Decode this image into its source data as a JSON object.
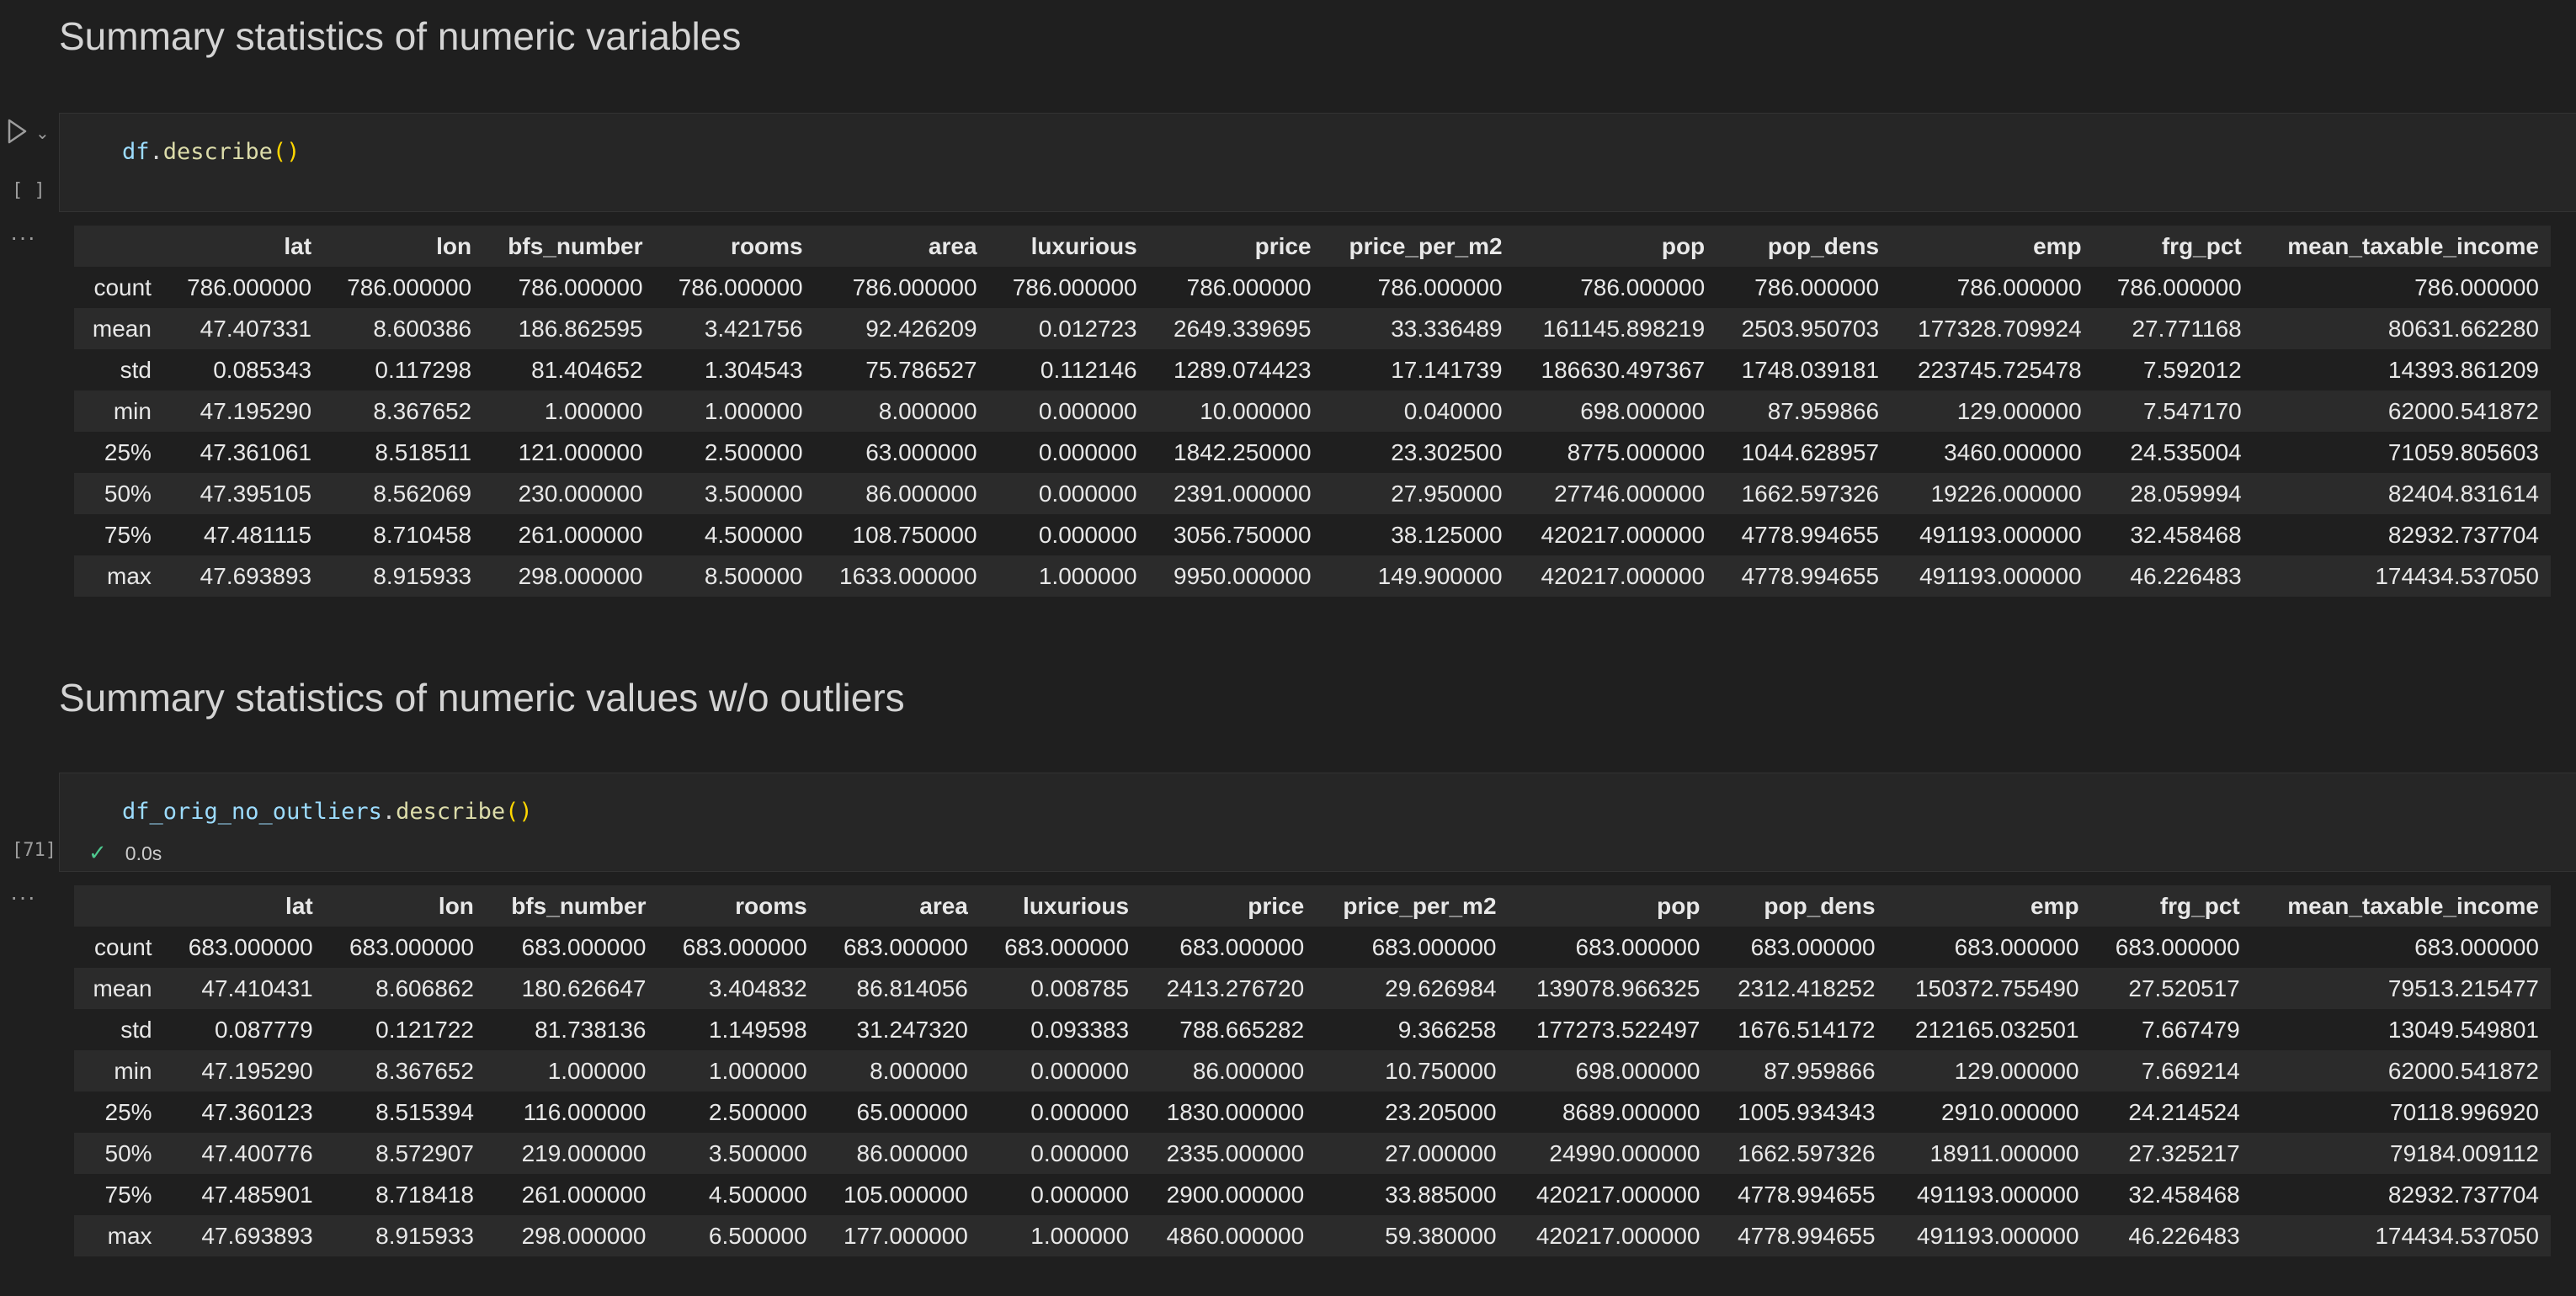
{
  "section1": {
    "heading": "Summary statistics of numeric variables",
    "cell": {
      "code": {
        "var": "df",
        "dot": ".",
        "fn": "describe",
        "parens": "()"
      },
      "exec_count": "[ ]",
      "more": "···"
    },
    "table": {
      "columns": [
        "lat",
        "lon",
        "bfs_number",
        "rooms",
        "area",
        "luxurious",
        "price",
        "price_per_m2",
        "pop",
        "pop_dens",
        "emp",
        "frg_pct",
        "mean_taxable_income"
      ],
      "rows": [
        {
          "label": "count",
          "values": [
            "786.000000",
            "786.000000",
            "786.000000",
            "786.000000",
            "786.000000",
            "786.000000",
            "786.000000",
            "786.000000",
            "786.000000",
            "786.000000",
            "786.000000",
            "786.000000",
            "786.000000"
          ]
        },
        {
          "label": "mean",
          "values": [
            "47.407331",
            "8.600386",
            "186.862595",
            "3.421756",
            "92.426209",
            "0.012723",
            "2649.339695",
            "33.336489",
            "161145.898219",
            "2503.950703",
            "177328.709924",
            "27.771168",
            "80631.662280"
          ]
        },
        {
          "label": "std",
          "values": [
            "0.085343",
            "0.117298",
            "81.404652",
            "1.304543",
            "75.786527",
            "0.112146",
            "1289.074423",
            "17.141739",
            "186630.497367",
            "1748.039181",
            "223745.725478",
            "7.592012",
            "14393.861209"
          ]
        },
        {
          "label": "min",
          "values": [
            "47.195290",
            "8.367652",
            "1.000000",
            "1.000000",
            "8.000000",
            "0.000000",
            "10.000000",
            "0.040000",
            "698.000000",
            "87.959866",
            "129.000000",
            "7.547170",
            "62000.541872"
          ]
        },
        {
          "label": "25%",
          "values": [
            "47.361061",
            "8.518511",
            "121.000000",
            "2.500000",
            "63.000000",
            "0.000000",
            "1842.250000",
            "23.302500",
            "8775.000000",
            "1044.628957",
            "3460.000000",
            "24.535004",
            "71059.805603"
          ]
        },
        {
          "label": "50%",
          "values": [
            "47.395105",
            "8.562069",
            "230.000000",
            "3.500000",
            "86.000000",
            "0.000000",
            "2391.000000",
            "27.950000",
            "27746.000000",
            "1662.597326",
            "19226.000000",
            "28.059994",
            "82404.831614"
          ]
        },
        {
          "label": "75%",
          "values": [
            "47.481115",
            "8.710458",
            "261.000000",
            "4.500000",
            "108.750000",
            "0.000000",
            "3056.750000",
            "38.125000",
            "420217.000000",
            "4778.994655",
            "491193.000000",
            "32.458468",
            "82932.737704"
          ]
        },
        {
          "label": "max",
          "values": [
            "47.693893",
            "8.915933",
            "298.000000",
            "8.500000",
            "1633.000000",
            "1.000000",
            "9950.000000",
            "149.900000",
            "420217.000000",
            "4778.994655",
            "491193.000000",
            "46.226483",
            "174434.537050"
          ]
        }
      ]
    }
  },
  "section2": {
    "heading": "Summary statistics of numeric values w/o outliers",
    "cell": {
      "code": {
        "var": "df_orig_no_outliers",
        "dot": ".",
        "fn": "describe",
        "parens": "()"
      },
      "exec_count": "[71]",
      "status": "0.0s",
      "more": "···"
    },
    "table": {
      "columns": [
        "lat",
        "lon",
        "bfs_number",
        "rooms",
        "area",
        "luxurious",
        "price",
        "price_per_m2",
        "pop",
        "pop_dens",
        "emp",
        "frg_pct",
        "mean_taxable_income"
      ],
      "rows": [
        {
          "label": "count",
          "values": [
            "683.000000",
            "683.000000",
            "683.000000",
            "683.000000",
            "683.000000",
            "683.000000",
            "683.000000",
            "683.000000",
            "683.000000",
            "683.000000",
            "683.000000",
            "683.000000",
            "683.000000"
          ]
        },
        {
          "label": "mean",
          "values": [
            "47.410431",
            "8.606862",
            "180.626647",
            "3.404832",
            "86.814056",
            "0.008785",
            "2413.276720",
            "29.626984",
            "139078.966325",
            "2312.418252",
            "150372.755490",
            "27.520517",
            "79513.215477"
          ]
        },
        {
          "label": "std",
          "values": [
            "0.087779",
            "0.121722",
            "81.738136",
            "1.149598",
            "31.247320",
            "0.093383",
            "788.665282",
            "9.366258",
            "177273.522497",
            "1676.514172",
            "212165.032501",
            "7.667479",
            "13049.549801"
          ]
        },
        {
          "label": "min",
          "values": [
            "47.195290",
            "8.367652",
            "1.000000",
            "1.000000",
            "8.000000",
            "0.000000",
            "86.000000",
            "10.750000",
            "698.000000",
            "87.959866",
            "129.000000",
            "7.669214",
            "62000.541872"
          ]
        },
        {
          "label": "25%",
          "values": [
            "47.360123",
            "8.515394",
            "116.000000",
            "2.500000",
            "65.000000",
            "0.000000",
            "1830.000000",
            "23.205000",
            "8689.000000",
            "1005.934343",
            "2910.000000",
            "24.214524",
            "70118.996920"
          ]
        },
        {
          "label": "50%",
          "values": [
            "47.400776",
            "8.572907",
            "219.000000",
            "3.500000",
            "86.000000",
            "0.000000",
            "2335.000000",
            "27.000000",
            "24990.000000",
            "1662.597326",
            "18911.000000",
            "27.325217",
            "79184.009112"
          ]
        },
        {
          "label": "75%",
          "values": [
            "47.485901",
            "8.718418",
            "261.000000",
            "4.500000",
            "105.000000",
            "0.000000",
            "2900.000000",
            "33.885000",
            "420217.000000",
            "4778.994655",
            "491193.000000",
            "32.458468",
            "82932.737704"
          ]
        },
        {
          "label": "max",
          "values": [
            "47.693893",
            "8.915933",
            "298.000000",
            "6.500000",
            "177.000000",
            "1.000000",
            "4860.000000",
            "59.380000",
            "420217.000000",
            "4778.994655",
            "491193.000000",
            "46.226483",
            "174434.537050"
          ]
        }
      ]
    }
  }
}
